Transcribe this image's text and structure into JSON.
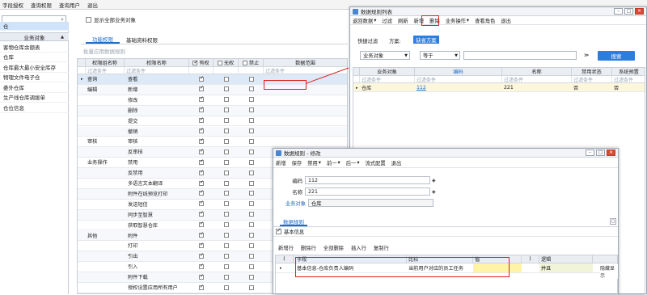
{
  "menubar": [
    "字段授权",
    "查询权限",
    "查询用户",
    "退出"
  ],
  "left": {
    "search_value": "",
    "header": "业务对象",
    "items": [
      "仓",
      "客物仓库余额表",
      "仓库",
      "仓库最大最小安全库存",
      "物理文件电子仓",
      "委外仓库",
      "生产线仓库调拨单",
      "仓位信息"
    ]
  },
  "show_all_label": "显示全部业务对象",
  "tabs": [
    "功能权限",
    "基础资料权限"
  ],
  "batch_label": "批量应用数据规则",
  "grid": {
    "headers": {
      "group": "权限组名称",
      "name": "权限名称",
      "has": "有权",
      "none": "无权",
      "forbid": "禁止",
      "scope": "数据范围"
    },
    "filter_text": "过滤条件",
    "rows": [
      {
        "group": "查询",
        "name": "查看",
        "has": true,
        "mark": "▸"
      },
      {
        "group": "编辑",
        "name": "新增",
        "has": true
      },
      {
        "group": "",
        "name": "修改",
        "has": true
      },
      {
        "group": "",
        "name": "删除",
        "has": true
      },
      {
        "group": "",
        "name": "提交",
        "has": true
      },
      {
        "group": "",
        "name": "撤销",
        "has": true
      },
      {
        "group": "审核",
        "name": "审核",
        "has": true
      },
      {
        "group": "",
        "name": "反审核",
        "has": true
      },
      {
        "group": "业务操作",
        "name": "禁用",
        "has": true
      },
      {
        "group": "",
        "name": "反禁用",
        "has": true
      },
      {
        "group": "",
        "name": "多语言文本翻译",
        "has": true
      },
      {
        "group": "",
        "name": "附件在线预览打印",
        "has": true
      },
      {
        "group": "",
        "name": "发送短信",
        "has": true
      },
      {
        "group": "",
        "name": "同步至智慧",
        "has": true
      },
      {
        "group": "",
        "name": "获取智慧仓库",
        "has": true
      },
      {
        "group": "其他",
        "name": "附件",
        "has": true
      },
      {
        "group": "",
        "name": "打印",
        "has": true
      },
      {
        "group": "",
        "name": "引出",
        "has": true
      },
      {
        "group": "",
        "name": "引入",
        "has": true
      },
      {
        "group": "",
        "name": "附件下载",
        "has": true
      },
      {
        "group": "",
        "name": "授权设置应用所有用户",
        "has": true
      }
    ]
  },
  "win1": {
    "title": "数据规则列表",
    "toolbar": [
      "返回数据",
      "过滤",
      "刷新",
      "新增",
      "删除",
      "业务操作",
      "查看角色",
      "退出"
    ],
    "quick_filter": "快捷过滤",
    "scheme": "方案:",
    "scheme_btn": "缺省方案",
    "field_select": "业务对象",
    "op_select": "等于",
    "search_btn": "搜索",
    "grid_headers": [
      "业务对象",
      "编码",
      "名称",
      "禁用状态",
      "系统预置"
    ],
    "filter_text": "过滤条件",
    "rows": [
      {
        "obj": "仓库",
        "code": "112",
        "name": "221",
        "disabled": "否",
        "preset": "否"
      }
    ]
  },
  "win2": {
    "title": "数据规则 - 修改",
    "toolbar": [
      "新增",
      "保存",
      "禁用",
      "前一",
      "后一",
      "流式配置",
      "退出"
    ],
    "code_label": "编码",
    "code_value": "112",
    "name_label": "名称",
    "name_value": "221",
    "obj_label": "业务对象",
    "obj_value": "仓库",
    "tab_label": "数据规则",
    "section_label": "基本信息",
    "ops": [
      "新增行",
      "删除行",
      "全部删除",
      "插入行",
      "复制行"
    ],
    "grid_headers": [
      "(",
      "字段",
      "比较",
      "值",
      ")",
      "逻辑"
    ],
    "row": {
      "field": "基本信息-仓库负责人编码",
      "compare": "当前用户对应的员工任务",
      "value": "",
      "logic": "并且"
    },
    "side_text": "隐藏显示"
  }
}
